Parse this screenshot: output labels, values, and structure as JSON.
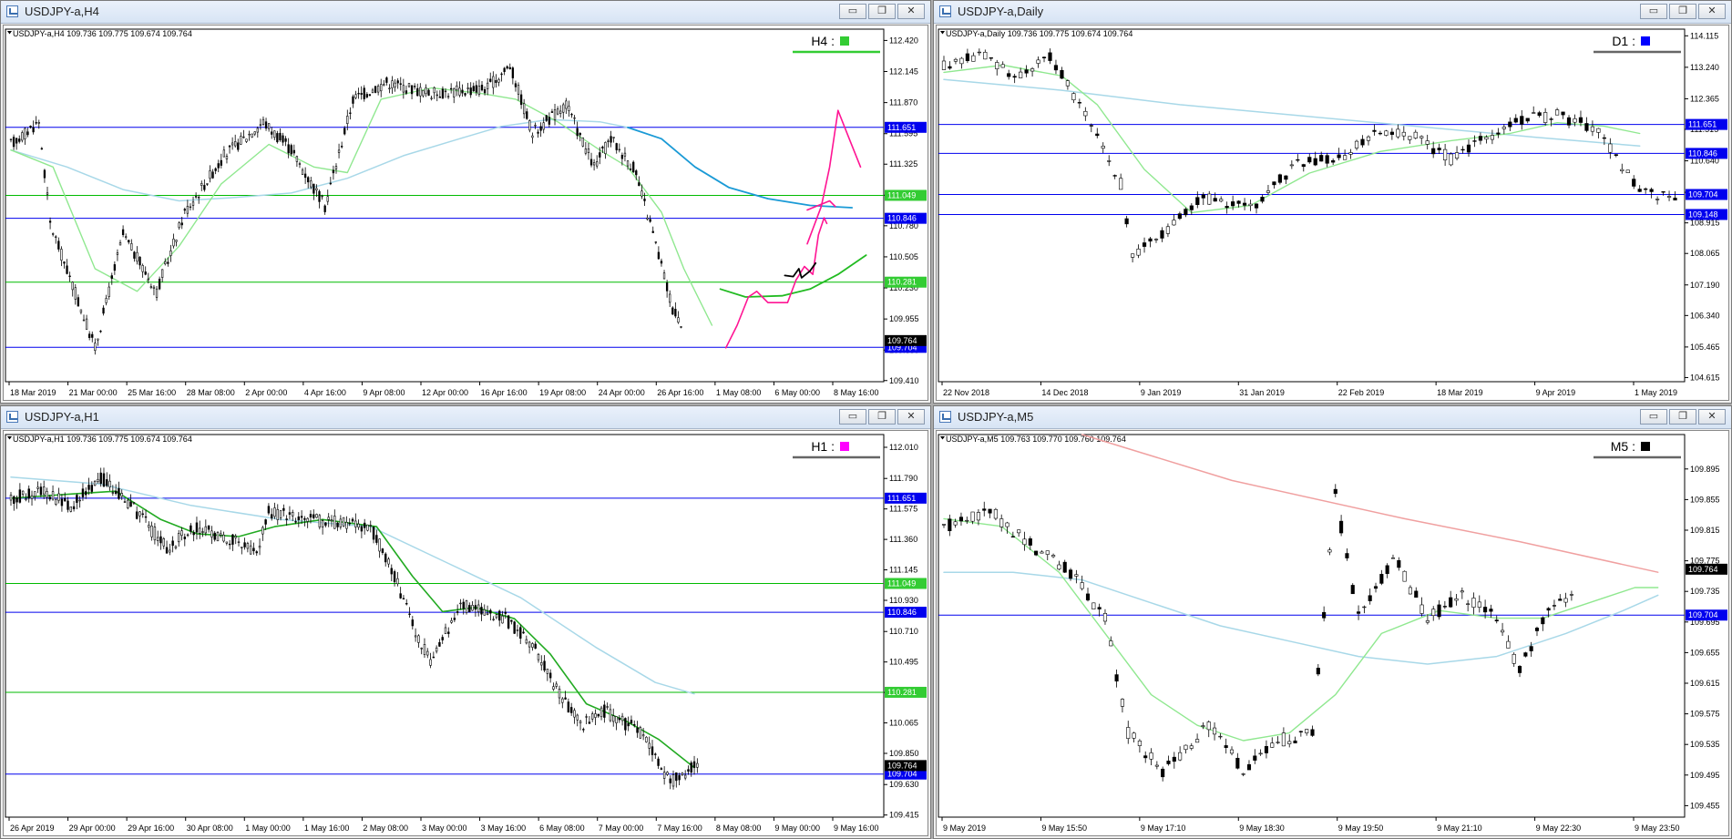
{
  "tfcolors": {
    "H4": "#33cc33",
    "D1": "#0000ff",
    "H1": "#ff00ff",
    "M5": "#000000"
  },
  "window_buttons": {
    "minimize": "▭",
    "restore": "❐",
    "close": "✕"
  },
  "charts": [
    {
      "title": "USDJPY-a,H4",
      "header": "USDJPY-a,H4  109.736 109.775 109.674 109.764",
      "tf": "H4 :",
      "tfcolor": "#33cc33",
      "ylim": [
        109.4,
        112.52
      ],
      "y_ticks": [
        "112.420",
        "112.145",
        "111.870",
        "111.595",
        "111.325",
        "111.050",
        "110.780",
        "110.505",
        "110.230",
        "109.955",
        "109.680",
        "109.410"
      ],
      "x_ticks": [
        "18 Mar 2019",
        "21 Mar 00:00",
        "25 Mar 16:00",
        "28 Mar 08:00",
        "2 Apr 00:00",
        "4 Apr 16:00",
        "9 Apr 08:00",
        "12 Apr 00:00",
        "16 Apr 16:00",
        "19 Apr 08:00",
        "24 Apr 00:00",
        "26 Apr 16:00",
        "1 May 08:00",
        "6 May 00:00",
        "8 May 16:00"
      ],
      "n_bars": 240,
      "price_path": [
        [
          0,
          111.5
        ],
        [
          10,
          111.7
        ],
        [
          14,
          110.8
        ],
        [
          30,
          109.7
        ],
        [
          40,
          110.7
        ],
        [
          52,
          110.2
        ],
        [
          62,
          110.9
        ],
        [
          76,
          111.4
        ],
        [
          90,
          111.7
        ],
        [
          100,
          111.45
        ],
        [
          112,
          110.95
        ],
        [
          122,
          111.9
        ],
        [
          134,
          112.05
        ],
        [
          150,
          111.95
        ],
        [
          170,
          112.0
        ],
        [
          178,
          112.2
        ],
        [
          186,
          111.6
        ],
        [
          198,
          111.85
        ],
        [
          208,
          111.3
        ],
        [
          214,
          111.55
        ],
        [
          222,
          111.3
        ],
        [
          228,
          110.8
        ],
        [
          236,
          110.05
        ],
        [
          246,
          109.65
        ],
        [
          256,
          109.72
        ]
      ],
      "price_lines": [
        {
          "value": 111.651,
          "label": "111.651",
          "color": "#0000ee",
          "kind": "blue"
        },
        {
          "value": 111.049,
          "label": "111.049",
          "color": "#00bb00",
          "kind": "green"
        },
        {
          "value": 110.846,
          "label": "110.846",
          "color": "#0000ee",
          "kind": "blue"
        },
        {
          "value": 110.281,
          "label": "110.281",
          "color": "#00bb00",
          "kind": "green"
        },
        {
          "value": 109.704,
          "label": "109.704",
          "color": "#0000ee",
          "kind": "blue"
        }
      ],
      "bid": {
        "value": 109.764,
        "label": "109.764"
      },
      "ma_fast": [
        [
          0,
          111.45
        ],
        [
          15,
          111.3
        ],
        [
          30,
          110.4
        ],
        [
          45,
          110.2
        ],
        [
          60,
          110.6
        ],
        [
          75,
          111.15
        ],
        [
          92,
          111.5
        ],
        [
          108,
          111.3
        ],
        [
          120,
          111.25
        ],
        [
          132,
          111.9
        ],
        [
          150,
          112.0
        ],
        [
          168,
          111.95
        ],
        [
          180,
          111.9
        ],
        [
          195,
          111.7
        ],
        [
          210,
          111.45
        ],
        [
          220,
          111.3
        ],
        [
          232,
          110.9
        ],
        [
          240,
          110.4
        ],
        [
          250,
          109.9
        ]
      ],
      "ma_slow": [
        [
          0,
          111.45
        ],
        [
          20,
          111.3
        ],
        [
          40,
          111.1
        ],
        [
          60,
          111.0
        ],
        [
          80,
          111.03
        ],
        [
          100,
          111.07
        ],
        [
          120,
          111.2
        ],
        [
          140,
          111.4
        ],
        [
          160,
          111.55
        ],
        [
          175,
          111.66
        ],
        [
          192,
          111.72
        ],
        [
          210,
          111.7
        ],
        [
          220,
          111.65
        ]
      ],
      "ma_slow_ext": [
        [
          220,
          111.65
        ],
        [
          232,
          111.55
        ],
        [
          244,
          111.3
        ],
        [
          256,
          111.12
        ],
        [
          270,
          111.02
        ],
        [
          285,
          110.96
        ],
        [
          300,
          110.94
        ]
      ],
      "ma_fast_ext": [
        [
          253,
          110.22
        ],
        [
          262,
          110.15
        ],
        [
          275,
          110.16
        ],
        [
          285,
          110.22
        ],
        [
          295,
          110.35
        ],
        [
          305,
          110.52
        ]
      ],
      "pink_path": [
        [
          255,
          109.7
        ],
        [
          259,
          109.9
        ],
        [
          263,
          110.15
        ],
        [
          266,
          110.2
        ],
        [
          270,
          110.1
        ],
        [
          277,
          110.1
        ],
        [
          280,
          110.3
        ],
        [
          283,
          110.42
        ],
        [
          286,
          110.35
        ],
        [
          288,
          110.7
        ],
        [
          290,
          110.85
        ],
        [
          291,
          110.8
        ]
      ],
      "pink_up": [
        [
          284,
          110.62
        ],
        [
          289,
          110.95
        ],
        [
          292,
          111.3
        ],
        [
          295,
          111.8
        ]
      ],
      "pink_right": [
        [
          295,
          111.8
        ],
        [
          299,
          111.55
        ],
        [
          303,
          111.3
        ]
      ],
      "pink_mark": [
        [
          284,
          110.92
        ],
        [
          292,
          111.0
        ],
        [
          294,
          110.95
        ]
      ],
      "black_path": [
        [
          276,
          110.34
        ],
        [
          279,
          110.33
        ],
        [
          281,
          110.4
        ],
        [
          282,
          110.32
        ],
        [
          285,
          110.38
        ],
        [
          287,
          110.45
        ]
      ],
      "x_extent": 310
    },
    {
      "title": "USDJPY-a,Daily",
      "header": "USDJPY-a,Daily  109.736 109.775 109.674 109.764",
      "tf": "D1 :",
      "tfcolor": "#0000ff",
      "ylim": [
        104.5,
        114.3
      ],
      "y_ticks": [
        "114.115",
        "113.240",
        "112.365",
        "111.515",
        "110.640",
        "109.765",
        "108.915",
        "108.065",
        "107.190",
        "106.340",
        "105.465",
        "104.615"
      ],
      "x_ticks": [
        "22 Nov 2018",
        "14 Dec 2018",
        "9 Jan 2019",
        "31 Jan 2019",
        "22 Feb 2019",
        "18 Mar 2019",
        "9 Apr 2019",
        "1 May 2019"
      ],
      "n_bars": 125,
      "price_path": [
        [
          0,
          113.3
        ],
        [
          6,
          113.6
        ],
        [
          12,
          113.0
        ],
        [
          18,
          113.5
        ],
        [
          22,
          112.5
        ],
        [
          26,
          111.4
        ],
        [
          30,
          110.0
        ],
        [
          32,
          108.0
        ],
        [
          36,
          108.5
        ],
        [
          44,
          109.6
        ],
        [
          52,
          109.3
        ],
        [
          60,
          110.6
        ],
        [
          68,
          110.8
        ],
        [
          74,
          111.5
        ],
        [
          80,
          111.3
        ],
        [
          86,
          110.7
        ],
        [
          92,
          111.3
        ],
        [
          98,
          111.8
        ],
        [
          104,
          111.9
        ],
        [
          110,
          111.6
        ],
        [
          115,
          110.5
        ],
        [
          118,
          109.7
        ]
      ],
      "price_lines": [
        {
          "value": 111.651,
          "label": "111.651",
          "color": "#0000ee",
          "kind": "blue"
        },
        {
          "value": 110.846,
          "label": "110.846",
          "color": "#0000ee",
          "kind": "blue"
        },
        {
          "value": 109.704,
          "label": "109.704",
          "color": "#0000ee",
          "kind": "blue"
        },
        {
          "value": 109.148,
          "label": "109.148",
          "color": "#0000ee",
          "kind": "blue"
        }
      ],
      "bid": null,
      "ma_fast": [
        [
          0,
          113.1
        ],
        [
          10,
          113.3
        ],
        [
          20,
          113.0
        ],
        [
          26,
          112.2
        ],
        [
          34,
          110.4
        ],
        [
          42,
          109.2
        ],
        [
          52,
          109.4
        ],
        [
          62,
          110.3
        ],
        [
          74,
          110.9
        ],
        [
          86,
          111.2
        ],
        [
          96,
          111.4
        ],
        [
          104,
          111.7
        ],
        [
          112,
          111.6
        ],
        [
          118,
          111.4
        ]
      ],
      "ma_slow": [
        [
          0,
          112.9
        ],
        [
          20,
          112.6
        ],
        [
          40,
          112.2
        ],
        [
          60,
          111.9
        ],
        [
          80,
          111.6
        ],
        [
          100,
          111.3
        ],
        [
          118,
          111.05
        ]
      ],
      "x_extent": 125
    },
    {
      "title": "USDJPY-a,H1",
      "header": "USDJPY-a,H1  109.736 109.775 109.674 109.764",
      "tf": "H1 :",
      "tfcolor": "#ff00ff",
      "ylim": [
        109.4,
        112.1
      ],
      "y_ticks": [
        "112.010",
        "111.790",
        "111.575",
        "111.360",
        "111.145",
        "110.930",
        "110.710",
        "110.495",
        "110.280",
        "110.065",
        "109.850",
        "109.630",
        "109.415"
      ],
      "x_ticks": [
        "26 Apr 2019",
        "29 Apr 00:00",
        "29 Apr 16:00",
        "30 Apr 08:00",
        "1 May 00:00",
        "1 May 16:00",
        "2 May 08:00",
        "3 May 00:00",
        "3 May 16:00",
        "6 May 08:00",
        "7 May 00:00",
        "7 May 16:00",
        "8 May 08:00",
        "9 May 00:00",
        "9 May 16:00"
      ],
      "n_bars": 230,
      "price_path": [
        [
          0,
          111.65
        ],
        [
          10,
          111.7
        ],
        [
          20,
          111.6
        ],
        [
          30,
          111.8
        ],
        [
          40,
          111.6
        ],
        [
          52,
          111.3
        ],
        [
          62,
          111.45
        ],
        [
          74,
          111.35
        ],
        [
          82,
          111.25
        ],
        [
          86,
          111.55
        ],
        [
          100,
          111.5
        ],
        [
          120,
          111.45
        ],
        [
          128,
          111.1
        ],
        [
          135,
          110.7
        ],
        [
          140,
          110.5
        ],
        [
          150,
          110.9
        ],
        [
          165,
          110.8
        ],
        [
          175,
          110.6
        ],
        [
          182,
          110.3
        ],
        [
          190,
          110.05
        ],
        [
          198,
          110.15
        ],
        [
          210,
          110.0
        ],
        [
          220,
          109.65
        ],
        [
          228,
          109.75
        ]
      ],
      "price_lines": [
        {
          "value": 111.651,
          "label": "111.651",
          "color": "#0000ee",
          "kind": "blue"
        },
        {
          "value": 111.049,
          "label": "111.049",
          "color": "#00bb00",
          "kind": "green"
        },
        {
          "value": 110.846,
          "label": "110.846",
          "color": "#0000ee",
          "kind": "blue"
        },
        {
          "value": 110.281,
          "label": "110.281",
          "color": "#00bb00",
          "kind": "green"
        },
        {
          "value": 109.704,
          "label": "109.704",
          "color": "#0000ee",
          "kind": "blue"
        }
      ],
      "bid": {
        "value": 109.764,
        "label": "109.764"
      },
      "ma_fast": [
        [
          0,
          111.65
        ],
        [
          20,
          111.68
        ],
        [
          35,
          111.7
        ],
        [
          50,
          111.5
        ],
        [
          62,
          111.4
        ],
        [
          76,
          111.38
        ],
        [
          88,
          111.45
        ],
        [
          104,
          111.5
        ],
        [
          122,
          111.45
        ],
        [
          134,
          111.1
        ],
        [
          144,
          110.85
        ],
        [
          155,
          110.88
        ],
        [
          168,
          110.8
        ],
        [
          180,
          110.55
        ],
        [
          192,
          110.2
        ],
        [
          205,
          110.08
        ],
        [
          216,
          109.95
        ],
        [
          228,
          109.75
        ]
      ],
      "ma_slow": [
        [
          0,
          111.8
        ],
        [
          30,
          111.75
        ],
        [
          60,
          111.6
        ],
        [
          90,
          111.5
        ],
        [
          120,
          111.45
        ],
        [
          145,
          111.2
        ],
        [
          170,
          110.95
        ],
        [
          195,
          110.6
        ],
        [
          215,
          110.35
        ],
        [
          228,
          110.27
        ]
      ],
      "x_extent": 290
    },
    {
      "title": "USDJPY-a,M5",
      "header": "USDJPY-a,M5  109.763 109.770 109.760 109.764",
      "tf": "M5 :",
      "tfcolor": "#000000",
      "ylim": [
        109.44,
        109.94
      ],
      "y_ticks": [
        "109.895",
        "109.855",
        "109.815",
        "109.775",
        "109.735",
        "109.695",
        "109.655",
        "109.615",
        "109.575",
        "109.535",
        "109.495",
        "109.455"
      ],
      "x_ticks": [
        "9 May 2019",
        "9 May 15:50",
        "9 May 17:10",
        "9 May 18:30",
        "9 May 19:50",
        "9 May 21:10",
        "9 May 22:30",
        "9 May 23:50"
      ],
      "n_bars": 110,
      "price_path": [
        [
          0,
          109.82
        ],
        [
          8,
          109.84
        ],
        [
          16,
          109.79
        ],
        [
          22,
          109.76
        ],
        [
          28,
          109.7
        ],
        [
          32,
          109.55
        ],
        [
          38,
          109.5
        ],
        [
          46,
          109.56
        ],
        [
          52,
          109.5
        ],
        [
          58,
          109.54
        ],
        [
          64,
          109.55
        ],
        [
          68,
          109.86
        ],
        [
          72,
          109.7
        ],
        [
          78,
          109.78
        ],
        [
          84,
          109.7
        ],
        [
          90,
          109.73
        ],
        [
          96,
          109.7
        ],
        [
          100,
          109.63
        ],
        [
          104,
          109.7
        ],
        [
          110,
          109.74
        ],
        [
          114,
          109.72
        ],
        [
          118,
          109.78
        ],
        [
          120,
          109.68
        ],
        [
          124,
          109.76
        ]
      ],
      "price_lines": [
        {
          "value": 109.704,
          "label": "109.704",
          "color": "#0000ee",
          "kind": "blue"
        }
      ],
      "bid": {
        "value": 109.764,
        "label": "109.764"
      },
      "ma_fast": [
        [
          0,
          109.83
        ],
        [
          10,
          109.82
        ],
        [
          20,
          109.76
        ],
        [
          28,
          109.68
        ],
        [
          36,
          109.6
        ],
        [
          44,
          109.56
        ],
        [
          52,
          109.54
        ],
        [
          60,
          109.55
        ],
        [
          68,
          109.6
        ],
        [
          76,
          109.68
        ],
        [
          86,
          109.71
        ],
        [
          96,
          109.7
        ],
        [
          104,
          109.7
        ],
        [
          112,
          109.72
        ],
        [
          120,
          109.74
        ],
        [
          124,
          109.74
        ]
      ],
      "ma_slow": [
        [
          0,
          109.76
        ],
        [
          12,
          109.76
        ],
        [
          24,
          109.75
        ],
        [
          36,
          109.72
        ],
        [
          48,
          109.69
        ],
        [
          60,
          109.67
        ],
        [
          72,
          109.65
        ],
        [
          84,
          109.64
        ],
        [
          96,
          109.65
        ],
        [
          108,
          109.68
        ],
        [
          118,
          109.71
        ],
        [
          124,
          109.73
        ]
      ],
      "ma_pink": [
        [
          24,
          109.94
        ],
        [
          50,
          109.88
        ],
        [
          80,
          109.83
        ],
        [
          100,
          109.8
        ],
        [
          118,
          109.77
        ],
        [
          124,
          109.76
        ]
      ],
      "x_extent": 128
    }
  ]
}
